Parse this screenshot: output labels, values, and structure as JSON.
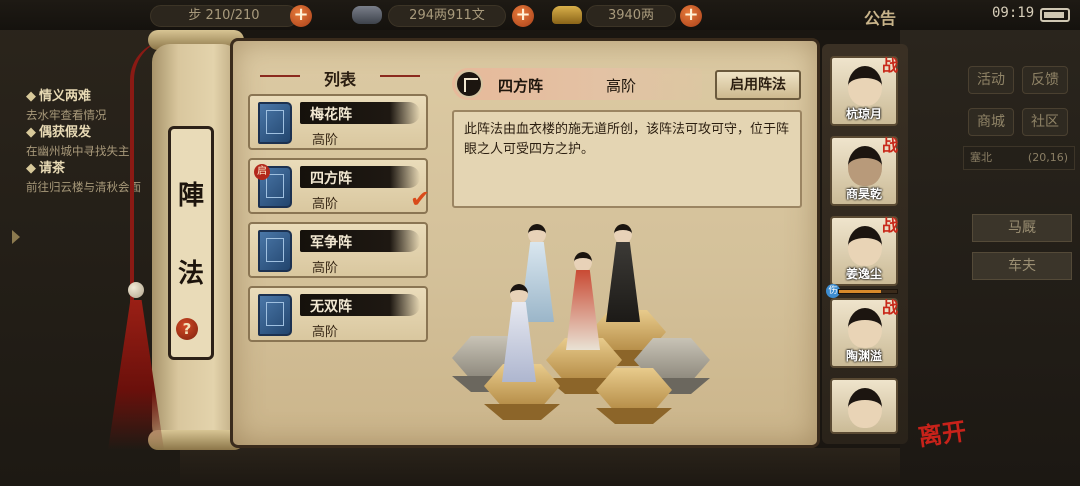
{
  "topbar": {
    "stat1": "步 210/210",
    "copper": "294两911文",
    "gold": "3940两",
    "notice": "公告",
    "time": "09:19"
  },
  "quests": [
    {
      "title": "情义两难",
      "desc": "去水牢查看情况"
    },
    {
      "title": "偶获假发",
      "desc": "在幽州城中寻找失主"
    },
    {
      "title": "请茶",
      "desc": "前往归云楼与清秋会面"
    }
  ],
  "right_menu": {
    "activity": "活动",
    "feedback": "反馈",
    "shop": "商城",
    "community": "社区",
    "location": "塞北",
    "coords": "(20,16)",
    "npc1": "马厩",
    "npc2": "车夫"
  },
  "scroll": {
    "char1": "陣",
    "char2": "法",
    "help": "?"
  },
  "list": {
    "header": "列表",
    "items": [
      {
        "name": "梅花阵",
        "tier": "高阶"
      },
      {
        "name": "四方阵",
        "tier": "高阶",
        "badge": "启"
      },
      {
        "name": "军争阵",
        "tier": "高阶"
      },
      {
        "name": "无双阵",
        "tier": "高阶"
      }
    ]
  },
  "detail": {
    "name": "四方阵",
    "tier": "高阶",
    "enable_button": "启用阵法",
    "description": "此阵法由血衣楼的施无道所创，该阵法可攻可守，位于阵眼之人可受四方之护。"
  },
  "roster": [
    {
      "name": "杭琼月",
      "tag": "战"
    },
    {
      "name": "商昊乾",
      "tag": "战"
    },
    {
      "name": "姜逸尘",
      "tag": "战"
    },
    {
      "name": "陶渊溢",
      "tag": "战"
    },
    {
      "name": "",
      "tag": ""
    }
  ],
  "leave": "离开",
  "colors": {
    "accent_red": "#c9281a",
    "parchment": "#d4c19a",
    "ink": "#1e150c"
  }
}
